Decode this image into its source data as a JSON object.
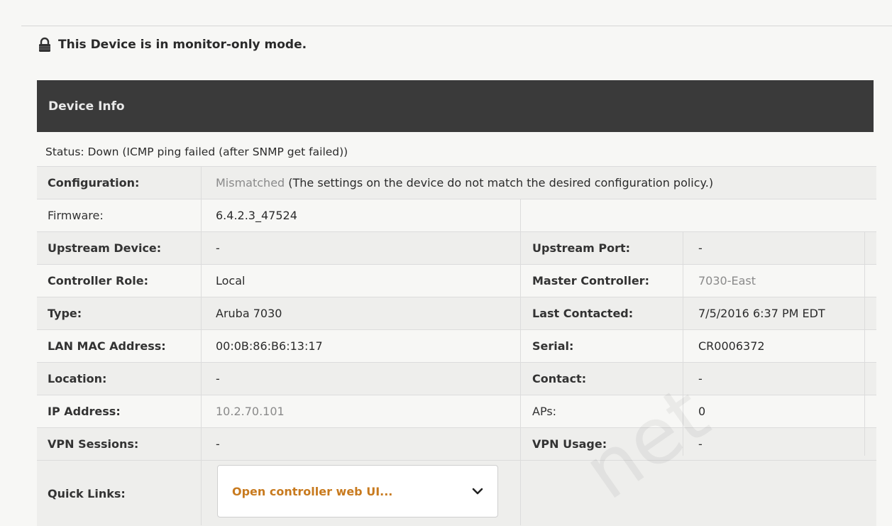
{
  "notice": {
    "text": "This Device is in monitor-only mode."
  },
  "panel": {
    "title": "Device Info"
  },
  "status": {
    "text": "Status: Down (ICMP ping failed (after SNMP get failed))"
  },
  "configuration": {
    "label": "Configuration:",
    "state": "Mismatched",
    "detail": " (The settings on the device do not match the desired configuration policy.)"
  },
  "firmware": {
    "label": "Firmware:",
    "value": "6.4.2.3_47524"
  },
  "rows": [
    {
      "l1": "Upstream Device:",
      "v1": "-",
      "l2": "Upstream Port:",
      "v2": "-"
    },
    {
      "l1": "Controller Role:",
      "v1": "Local",
      "l2": "Master Controller:",
      "v2": "7030-East"
    },
    {
      "l1": "Type:",
      "v1": "Aruba 7030",
      "l2": "Last Contacted:",
      "v2": "7/5/2016 6:37 PM EDT"
    },
    {
      "l1": "LAN MAC Address:",
      "v1": "00:0B:86:B6:13:17",
      "l2": "Serial:",
      "v2": "CR0006372"
    },
    {
      "l1": "Location:",
      "v1": "-",
      "l2": "Contact:",
      "v2": "-"
    },
    {
      "l1": "IP Address:",
      "v1": "10.2.70.101",
      "l2": "APs:",
      "v2": "0"
    },
    {
      "l1": "VPN Sessions:",
      "v1": "-",
      "l2": "VPN Usage:",
      "v2": "-"
    }
  ],
  "quick_links": {
    "label": "Quick Links:",
    "selected": "Open controller web UI..."
  },
  "watermark": "net",
  "colors": {
    "header_bg": "#3a3a3a",
    "link_orange": "#c87a1e",
    "muted": "#8a8a8a"
  },
  "icons": {
    "notice": "lock-icon",
    "dropdown": "chevron-down-icon"
  }
}
